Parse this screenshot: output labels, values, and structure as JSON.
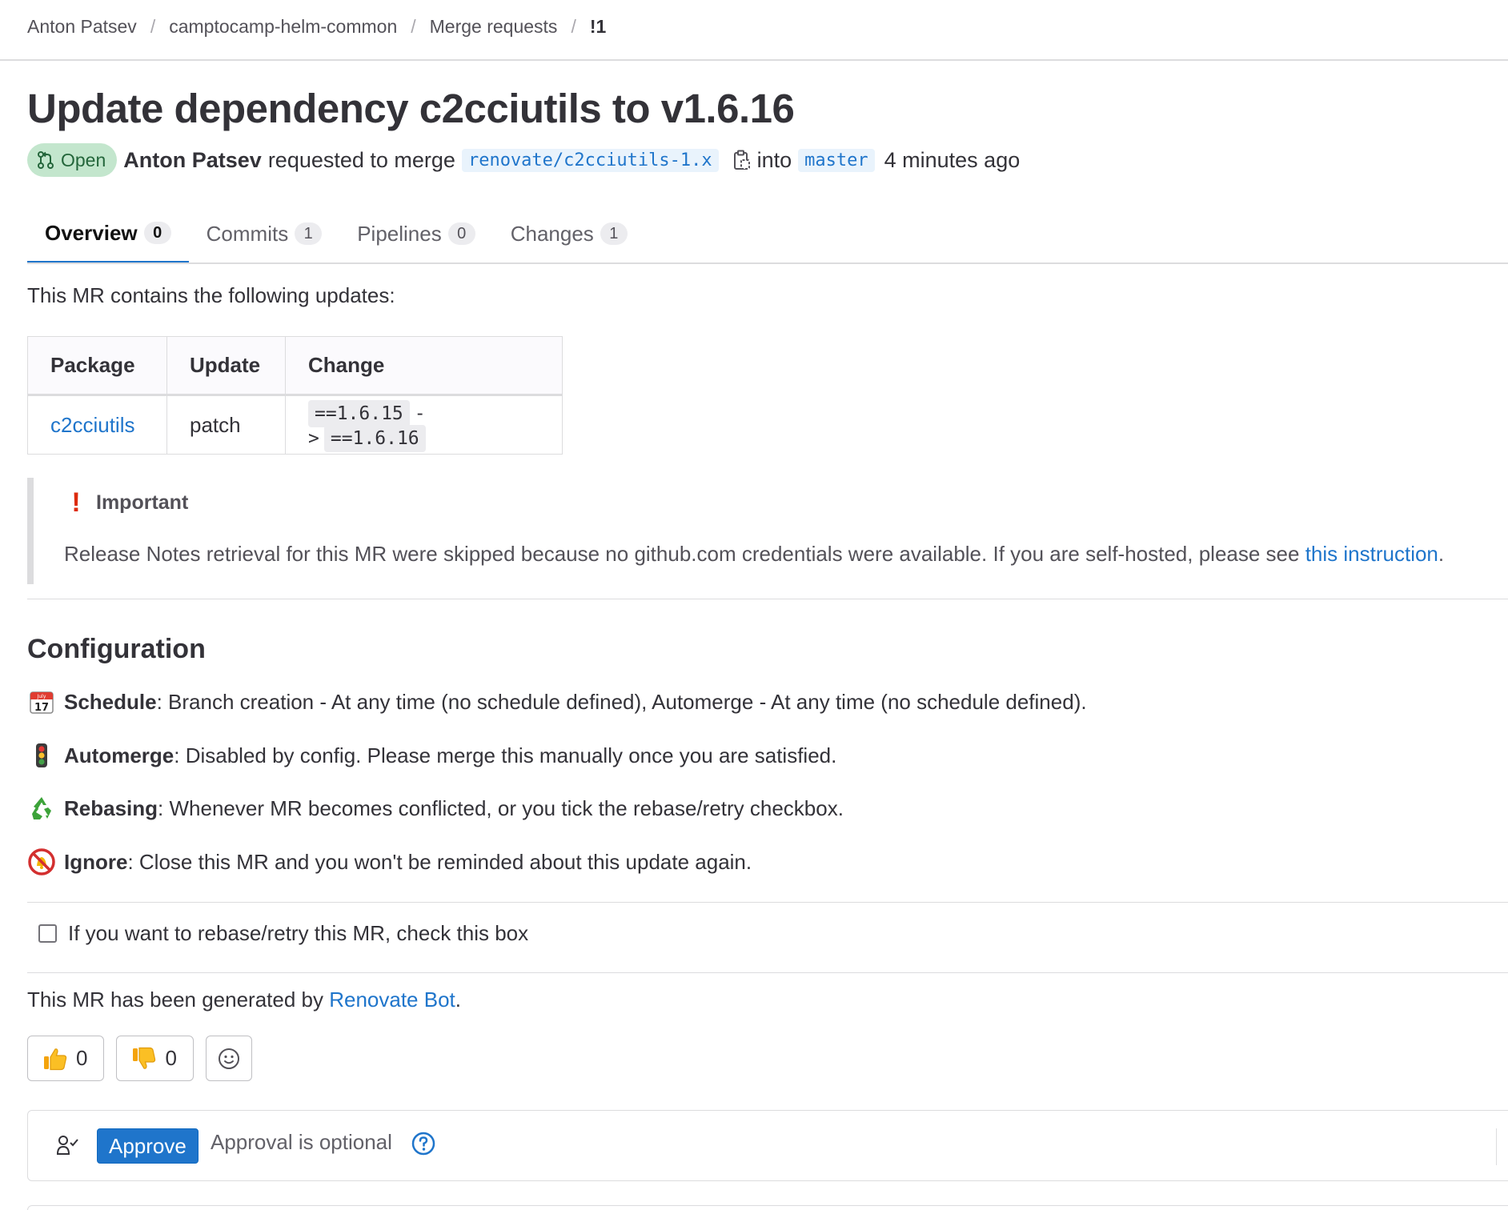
{
  "breadcrumb": {
    "items": [
      "Anton Patsev",
      "camptocamp-helm-common",
      "Merge requests"
    ],
    "current": "!1",
    "separator": "/"
  },
  "merge_request": {
    "title": "Update dependency c2cciutils to v1.6.16",
    "status": "Open",
    "author": "Anton Patsev",
    "action_text": "requested to merge",
    "source_branch": "renovate/c2cciutils-1.x",
    "into_text": "into",
    "target_branch": "master",
    "time_ago": "4 minutes ago"
  },
  "tabs": [
    {
      "label": "Overview",
      "count": "0",
      "active": true
    },
    {
      "label": "Commits",
      "count": "1",
      "active": false
    },
    {
      "label": "Pipelines",
      "count": "0",
      "active": false
    },
    {
      "label": "Changes",
      "count": "1",
      "active": false
    }
  ],
  "description": {
    "intro": "This MR contains the following updates:",
    "table": {
      "headers": [
        "Package",
        "Update",
        "Change"
      ],
      "rows": [
        {
          "package": "c2cciutils",
          "update": "patch",
          "from": "==1.6.15",
          "arrow": "->",
          "to": "==1.6.16"
        }
      ]
    },
    "important": {
      "title": "Important",
      "text": "Release Notes retrieval for this MR were skipped because no github.com credentials were available. If you are self-hosted, please see ",
      "link": "this instruction",
      "end": "."
    },
    "configuration": {
      "title": "Configuration",
      "items": [
        {
          "icon": "calendar-icon",
          "label": "Schedule",
          "text": ": Branch creation - At any time (no schedule defined), Automerge - At any time (no schedule defined)."
        },
        {
          "icon": "traffic-light-icon",
          "label": "Automerge",
          "text": ": Disabled by config. Please merge this manually once you are satisfied."
        },
        {
          "icon": "recycle-icon",
          "label": "Rebasing",
          "text": ": Whenever MR becomes conflicted, or you tick the rebase/retry checkbox."
        },
        {
          "icon": "no-bell-icon",
          "label": "Ignore",
          "text": ": Close this MR and you won't be reminded about this update again."
        }
      ]
    },
    "rebase_checkbox": {
      "label": "If you want to rebase/retry this MR, check this box",
      "checked": false
    },
    "generated_prefix": "This MR has been generated by ",
    "generated_link": "Renovate Bot",
    "generated_suffix": "."
  },
  "awards": {
    "thumbs_up": "0",
    "thumbs_down": "0"
  },
  "approval": {
    "button": "Approve",
    "text": "Approval is optional"
  },
  "colors": {
    "link": "#1f75cb",
    "open_badge_bg": "#c3e6cd",
    "open_badge_text": "#24663b",
    "approve_button": "#1f75cb",
    "important_icon": "#dd2b0e"
  }
}
